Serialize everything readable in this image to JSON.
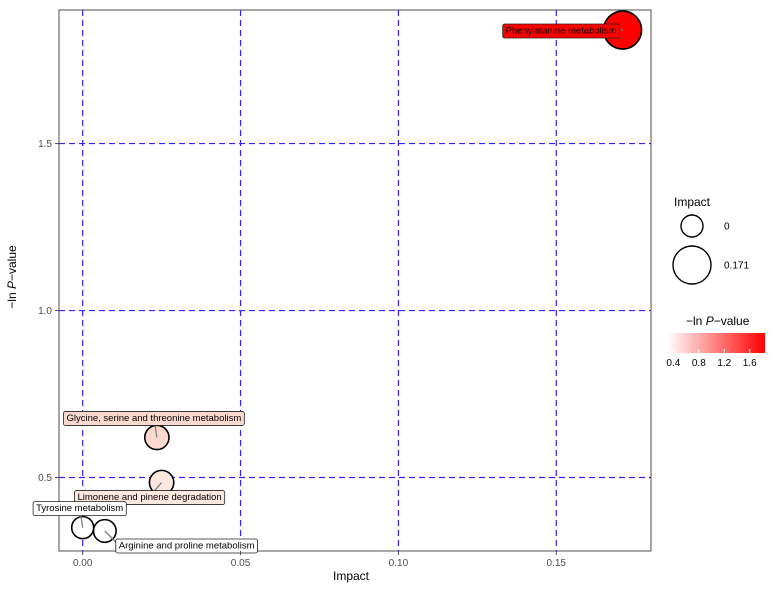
{
  "chart_data": {
    "type": "scatter",
    "title": "",
    "xlabel": "Impact",
    "ylabel_prefix": "−ln ",
    "ylabel_italic": "P",
    "ylabel_suffix": "−value",
    "xlim": [
      -0.0075,
      0.18
    ],
    "ylim": [
      0.28,
      1.9
    ],
    "x_ticks": [
      0.0,
      0.05,
      0.1,
      0.15
    ],
    "x_tick_labels": [
      "0.00",
      "0.05",
      "0.10",
      "0.15"
    ],
    "y_ticks": [
      0.5,
      1.0,
      1.5
    ],
    "y_tick_labels": [
      "0.5",
      "1.0",
      "1.5"
    ],
    "grid": true,
    "grid_color": "#3322ff",
    "points": [
      {
        "name": "Phenylalanine metabolism",
        "impact": 0.171,
        "neglogp": 1.84,
        "color": "#ff0000",
        "label_anchor": "left",
        "label_bg": "#ff0000"
      },
      {
        "name": "Glycine, serine and threonine metabolism",
        "impact": 0.0235,
        "neglogp": 0.62,
        "color": "#fcd9cf",
        "label_anchor": "up",
        "label_bg": "#fbd9cf"
      },
      {
        "name": "Limonene and pinene degradation",
        "impact": 0.025,
        "neglogp": 0.485,
        "color": "#fde7df",
        "label_anchor": "down",
        "label_bg": "#fde7df"
      },
      {
        "name": "Tyrosine metabolism",
        "impact": 0.0,
        "neglogp": 0.35,
        "color": "#ffffff",
        "label_anchor": "up",
        "label_bg": "#ffffff"
      },
      {
        "name": "Arginine and proline metabolism",
        "impact": 0.007,
        "neglogp": 0.34,
        "color": "#ffffff",
        "label_anchor": "down-right",
        "label_bg": "#ffffff"
      }
    ],
    "size_legend": {
      "title": "Impact",
      "entries": [
        {
          "label": "0",
          "value": 0.0
        },
        {
          "label": "0.171",
          "value": 0.171
        }
      ]
    },
    "color_legend": {
      "title_prefix": "−ln ",
      "title_italic": "P",
      "title_suffix": "−value",
      "range": [
        0.3,
        1.84
      ],
      "low_color": "#ffffff",
      "high_color": "#ff0000",
      "tick_values": [
        0.4,
        0.8,
        1.2,
        1.6
      ],
      "tick_labels": [
        "0.4",
        "0.8",
        "1.2",
        "1.6"
      ]
    }
  }
}
